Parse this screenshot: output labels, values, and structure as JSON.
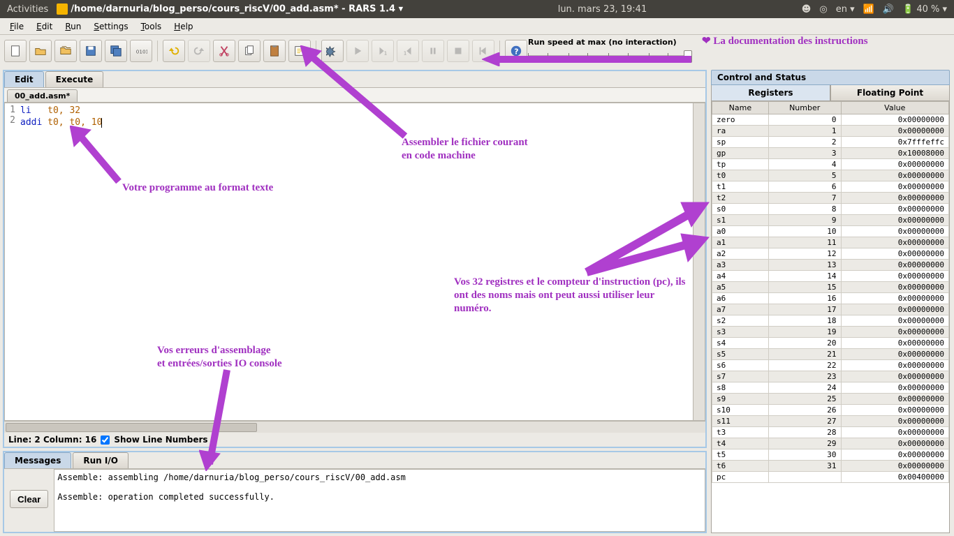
{
  "os": {
    "activities": "Activities",
    "title": "/home/darnuria/blog_perso/cours_riscV/00_add.asm* - RARS 1.4 ▾",
    "clock": "lun. mars 23, 19:41",
    "lang": "en ▾",
    "battery": "40 % ▾"
  },
  "menu": [
    "File",
    "Edit",
    "Run",
    "Settings",
    "Tools",
    "Help"
  ],
  "run_speed_label": "Run speed at max (no interaction)",
  "editor": {
    "tabs": {
      "edit": "Edit",
      "execute": "Execute"
    },
    "file_tab": "00_add.asm*",
    "lines": [
      {
        "n": "1",
        "op": "li",
        "args": "t0, 32"
      },
      {
        "n": "2",
        "op": "addi",
        "args": "t0, t0, 10"
      }
    ],
    "status": "Line: 2 Column: 16",
    "show_ln_label": "Show Line Numbers"
  },
  "messages": {
    "tabs": {
      "messages": "Messages",
      "runio": "Run I/O"
    },
    "clear": "Clear",
    "text": "Assemble: assembling /home/darnuria/blog_perso/cours_riscV/00_add.asm\n\nAssemble: operation completed successfully."
  },
  "right": {
    "title": "Control and Status",
    "tabs": {
      "registers": "Registers",
      "fp": "Floating Point"
    },
    "headers": {
      "name": "Name",
      "number": "Number",
      "value": "Value"
    },
    "rows": [
      {
        "name": "zero",
        "num": "0",
        "val": "0x00000000"
      },
      {
        "name": "ra",
        "num": "1",
        "val": "0x00000000"
      },
      {
        "name": "sp",
        "num": "2",
        "val": "0x7fffeffc"
      },
      {
        "name": "gp",
        "num": "3",
        "val": "0x10008000"
      },
      {
        "name": "tp",
        "num": "4",
        "val": "0x00000000"
      },
      {
        "name": "t0",
        "num": "5",
        "val": "0x00000000"
      },
      {
        "name": "t1",
        "num": "6",
        "val": "0x00000000"
      },
      {
        "name": "t2",
        "num": "7",
        "val": "0x00000000"
      },
      {
        "name": "s0",
        "num": "8",
        "val": "0x00000000"
      },
      {
        "name": "s1",
        "num": "9",
        "val": "0x00000000"
      },
      {
        "name": "a0",
        "num": "10",
        "val": "0x00000000"
      },
      {
        "name": "a1",
        "num": "11",
        "val": "0x00000000"
      },
      {
        "name": "a2",
        "num": "12",
        "val": "0x00000000"
      },
      {
        "name": "a3",
        "num": "13",
        "val": "0x00000000"
      },
      {
        "name": "a4",
        "num": "14",
        "val": "0x00000000"
      },
      {
        "name": "a5",
        "num": "15",
        "val": "0x00000000"
      },
      {
        "name": "a6",
        "num": "16",
        "val": "0x00000000"
      },
      {
        "name": "a7",
        "num": "17",
        "val": "0x00000000"
      },
      {
        "name": "s2",
        "num": "18",
        "val": "0x00000000"
      },
      {
        "name": "s3",
        "num": "19",
        "val": "0x00000000"
      },
      {
        "name": "s4",
        "num": "20",
        "val": "0x00000000"
      },
      {
        "name": "s5",
        "num": "21",
        "val": "0x00000000"
      },
      {
        "name": "s6",
        "num": "22",
        "val": "0x00000000"
      },
      {
        "name": "s7",
        "num": "23",
        "val": "0x00000000"
      },
      {
        "name": "s8",
        "num": "24",
        "val": "0x00000000"
      },
      {
        "name": "s9",
        "num": "25",
        "val": "0x00000000"
      },
      {
        "name": "s10",
        "num": "26",
        "val": "0x00000000"
      },
      {
        "name": "s11",
        "num": "27",
        "val": "0x00000000"
      },
      {
        "name": "t3",
        "num": "28",
        "val": "0x00000000"
      },
      {
        "name": "t4",
        "num": "29",
        "val": "0x00000000"
      },
      {
        "name": "t5",
        "num": "30",
        "val": "0x00000000"
      },
      {
        "name": "t6",
        "num": "31",
        "val": "0x00000000"
      },
      {
        "name": "pc",
        "num": "",
        "val": "0x00400000"
      }
    ]
  },
  "annot": {
    "doc": "La documentation des instructions",
    "assemble": "Assembler le fichier courant\nen code machine",
    "program": "Votre programme au format texte",
    "errors": "Vos erreurs d'assemblage\net entrées/sorties IO console",
    "registers": "Vos 32 registres et le compteur d'instruction (pc), ils ont des noms mais ont peut aussi utiliser leur numéro."
  }
}
